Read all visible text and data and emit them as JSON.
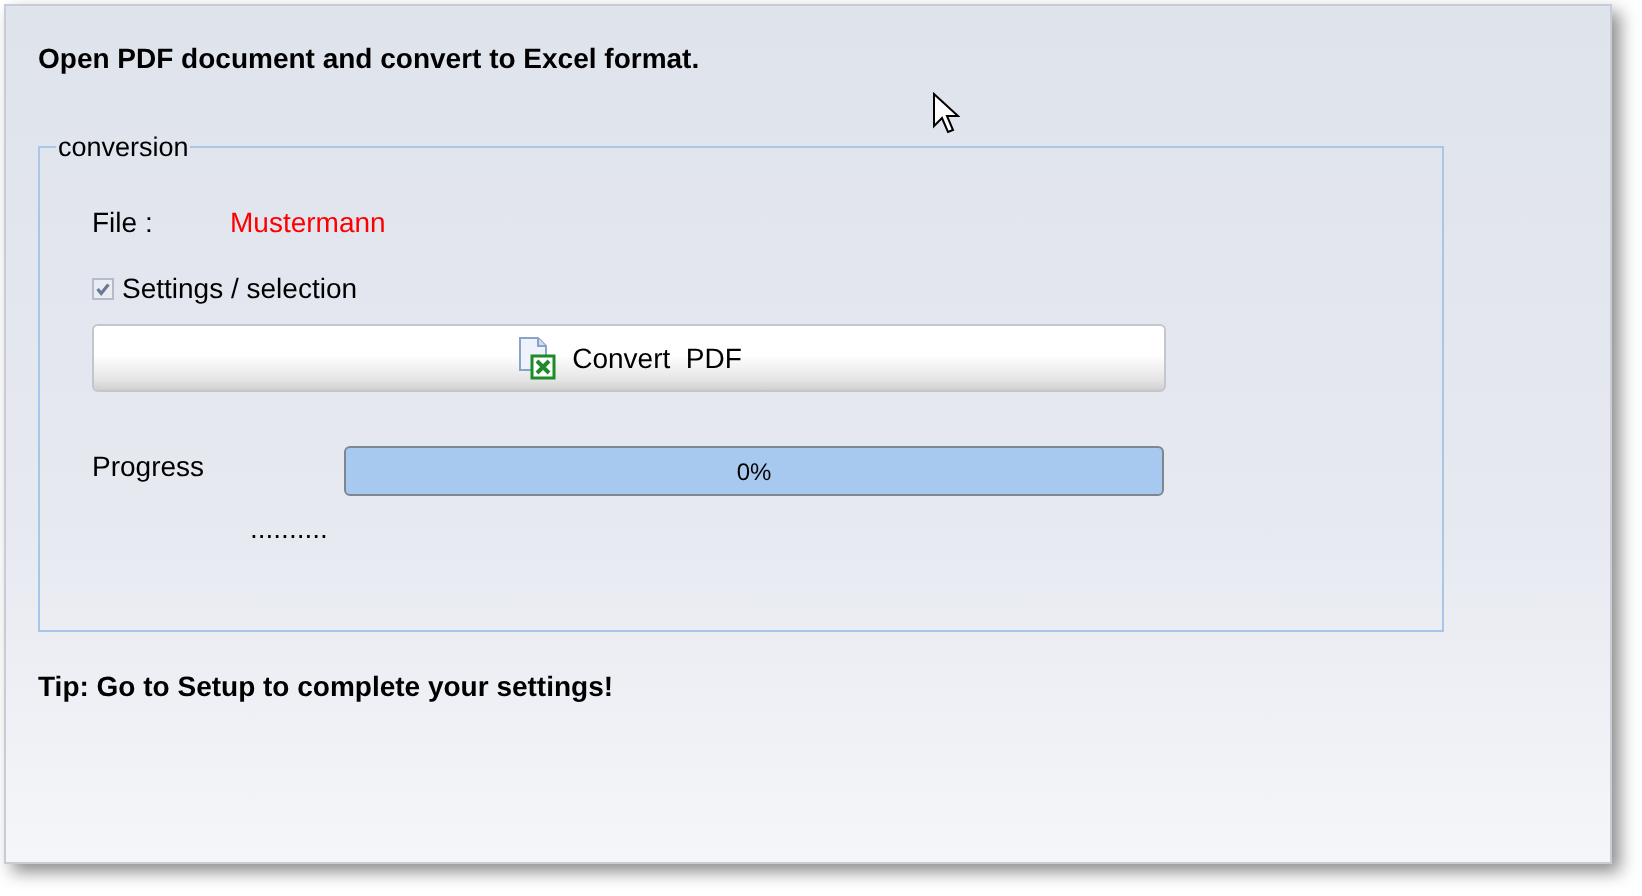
{
  "heading": "Open PDF document and convert to Excel format.",
  "conversion": {
    "legend": "conversion",
    "file": {
      "label": "File :",
      "value": "Mustermann"
    },
    "settings": {
      "label": "Settings / selection",
      "checked": true
    },
    "convert_button": {
      "label": "Convert  PDF"
    },
    "progress": {
      "label": "Progress",
      "level": 0,
      "reading": "0%"
    },
    "status": ".........."
  },
  "tip": "Tip: Go to Setup to complete your settings!"
}
